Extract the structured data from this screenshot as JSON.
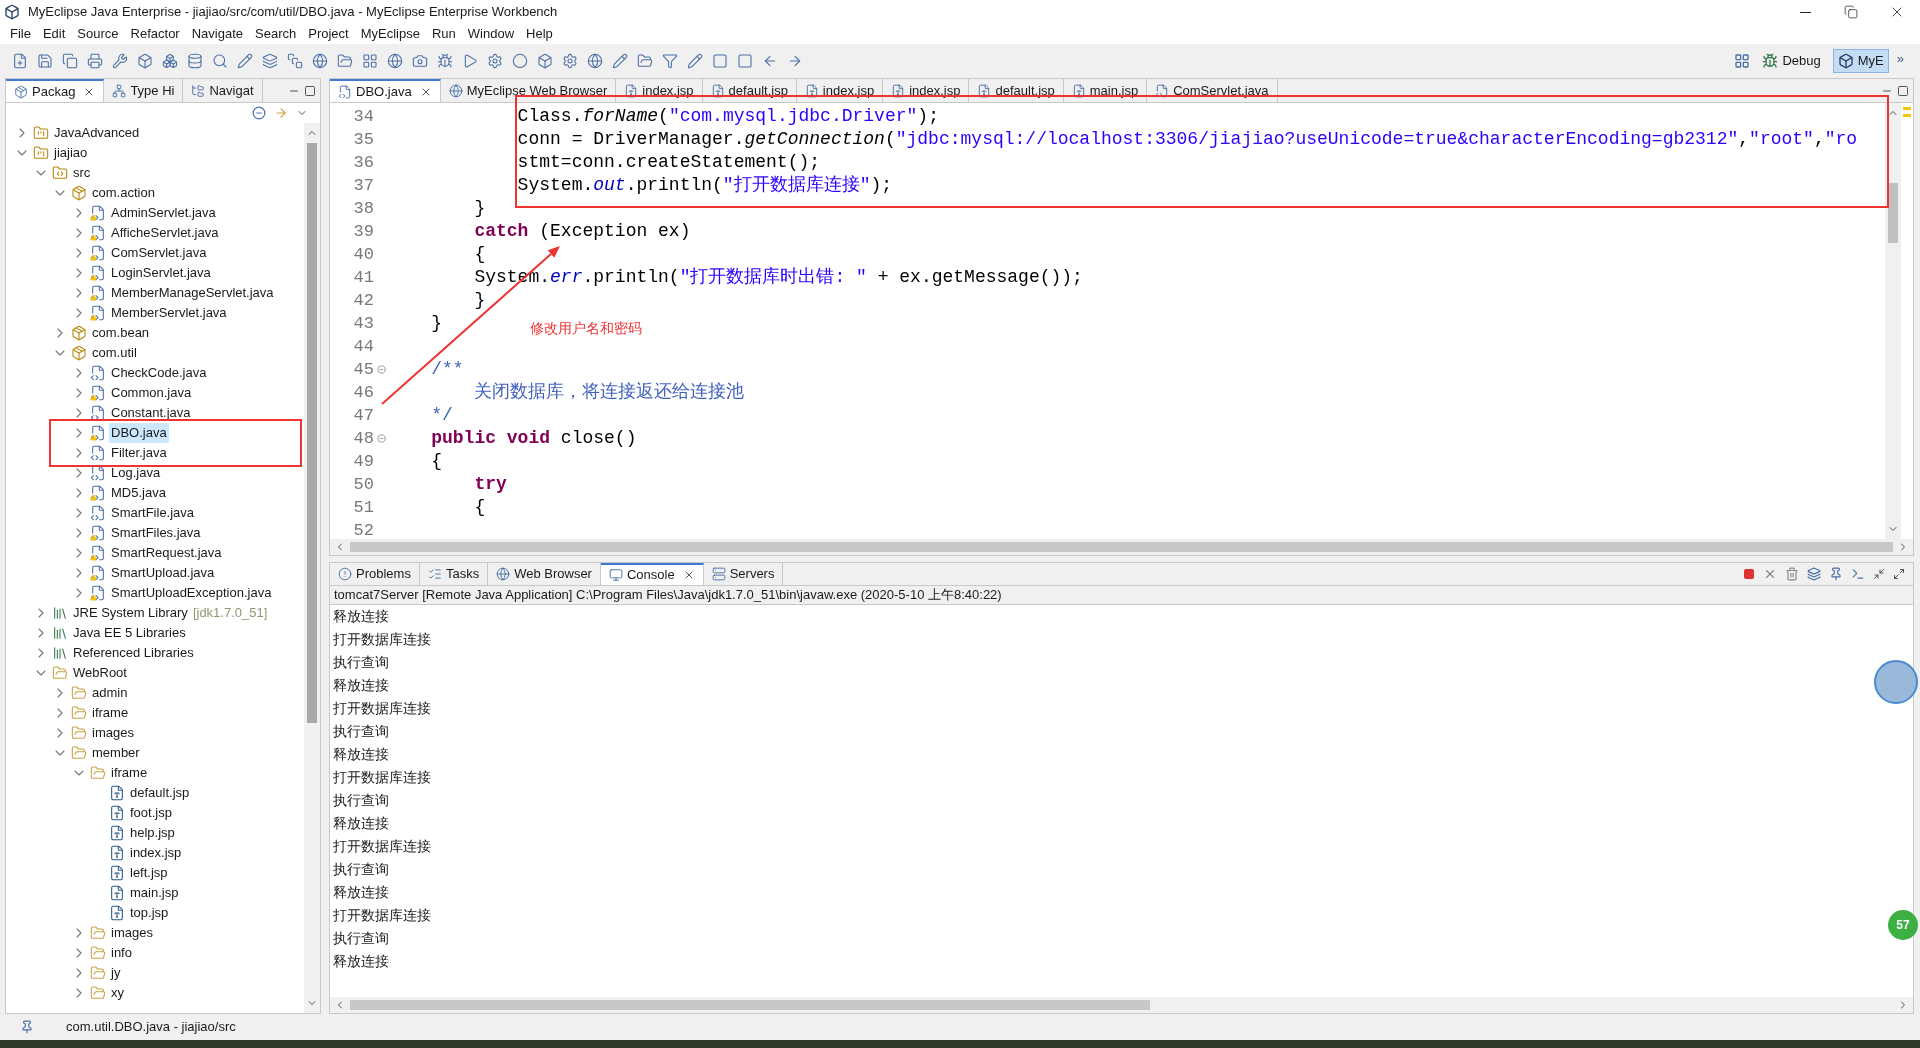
{
  "window": {
    "title": "MyEclipse Java Enterprise - jiajiao/src/com/util/DBO.java - MyEclipse Enterprise Workbench"
  },
  "menu": [
    "File",
    "Edit",
    "Source",
    "Refactor",
    "Navigate",
    "Search",
    "Project",
    "MyEclipse",
    "Run",
    "Window",
    "Help"
  ],
  "perspectives": [
    {
      "label": "Debug",
      "selected": false
    },
    {
      "label": "MyE",
      "selected": true
    }
  ],
  "perspective_more": "»",
  "left_tabs": [
    {
      "label": "Packag",
      "kind": "package",
      "selected": true
    },
    {
      "label": "Type Hi",
      "kind": "hierarchy",
      "selected": false
    },
    {
      "label": "Navigat",
      "kind": "navigator",
      "selected": false
    }
  ],
  "tree": [
    {
      "label": "JavaAdvanced",
      "kind": "project",
      "expanded": false
    },
    {
      "label": "jiajiao",
      "kind": "project",
      "expanded": true,
      "children": [
        {
          "label": "src",
          "kind": "source",
          "expanded": true,
          "children": [
            {
              "label": "com.action",
              "kind": "package",
              "expanded": true,
              "children": [
                {
                  "label": "AdminServlet.java",
                  "kind": "java",
                  "expanded": false,
                  "warning": true,
                  "selected": false
                },
                {
                  "label": "AfficheServlet.java",
                  "kind": "java",
                  "expanded": false,
                  "warning": true,
                  "selected": false
                },
                {
                  "label": "ComServlet.java",
                  "kind": "java",
                  "expanded": false,
                  "warning": true,
                  "selected": false
                },
                {
                  "label": "LoginServlet.java",
                  "kind": "java",
                  "expanded": false,
                  "warning": true,
                  "selected": false
                },
                {
                  "label": "MemberManageServlet.java",
                  "kind": "java",
                  "expanded": false,
                  "warning": true,
                  "selected": false
                },
                {
                  "label": "MemberServlet.java",
                  "kind": "java",
                  "expanded": false,
                  "warning": true,
                  "selected": false
                }
              ]
            },
            {
              "label": "com.bean",
              "kind": "package",
              "expanded": false
            },
            {
              "label": "com.util",
              "kind": "package",
              "expanded": true,
              "children": [
                {
                  "label": "CheckCode.java",
                  "kind": "java",
                  "expanded": false,
                  "warning": false,
                  "selected": false
                },
                {
                  "label": "Common.java",
                  "kind": "java",
                  "expanded": false,
                  "warning": true,
                  "selected": false
                },
                {
                  "label": "Constant.java",
                  "kind": "java",
                  "expanded": false,
                  "warning": false,
                  "selected": false
                },
                {
                  "label": "DBO.java",
                  "kind": "java",
                  "expanded": false,
                  "warning": true,
                  "selected": true
                },
                {
                  "label": "Filter.java",
                  "kind": "java",
                  "expanded": false,
                  "warning": false,
                  "selected": false
                },
                {
                  "label": "Log.java",
                  "kind": "java",
                  "expanded": false,
                  "warning": false,
                  "selected": false
                },
                {
                  "label": "MD5.java",
                  "kind": "java",
                  "expanded": false,
                  "warning": true,
                  "selected": false
                },
                {
                  "label": "SmartFile.java",
                  "kind": "java",
                  "expanded": false,
                  "warning": false,
                  "selected": false
                },
                {
                  "label": "SmartFiles.java",
                  "kind": "java",
                  "expanded": false,
                  "warning": true,
                  "selected": false
                },
                {
                  "label": "SmartRequest.java",
                  "kind": "java",
                  "expanded": false,
                  "warning": true,
                  "selected": false
                },
                {
                  "label": "SmartUpload.java",
                  "kind": "java",
                  "expanded": false,
                  "warning": true,
                  "selected": false
                },
                {
                  "label": "SmartUploadException.java",
                  "kind": "java",
                  "expanded": false,
                  "warning": true,
                  "selected": false
                }
              ]
            }
          ]
        },
        {
          "label": "JRE System Library",
          "decoration": "[jdk1.7.0_51]",
          "kind": "library",
          "expanded": false
        },
        {
          "label": "Java EE 5 Libraries",
          "kind": "library",
          "expanded": false
        },
        {
          "label": "Referenced Libraries",
          "kind": "library",
          "expanded": false
        },
        {
          "label": "WebRoot",
          "kind": "folder",
          "expanded": true,
          "children": [
            {
              "label": "admin",
              "kind": "folder",
              "expanded": false
            },
            {
              "label": "iframe",
              "kind": "folder",
              "expanded": false
            },
            {
              "label": "images",
              "kind": "folder",
              "expanded": false
            },
            {
              "label": "member",
              "kind": "folder",
              "expanded": true,
              "children": [
                {
                  "label": "iframe",
                  "kind": "folder",
                  "expanded": true,
                  "children": [
                    {
                      "label": "default.jsp",
                      "kind": "jsp"
                    },
                    {
                      "label": "foot.jsp",
                      "kind": "jsp"
                    },
                    {
                      "label": "help.jsp",
                      "kind": "jsp"
                    },
                    {
                      "label": "index.jsp",
                      "kind": "jsp"
                    },
                    {
                      "label": "left.jsp",
                      "kind": "jsp"
                    },
                    {
                      "label": "main.jsp",
                      "kind": "jsp"
                    },
                    {
                      "label": "top.jsp",
                      "kind": "jsp"
                    }
                  ]
                },
                {
                  "label": "images",
                  "kind": "folder",
                  "expanded": false
                },
                {
                  "label": "info",
                  "kind": "folder",
                  "expanded": false
                },
                {
                  "label": "jy",
                  "kind": "folder",
                  "expanded": false
                },
                {
                  "label": "xy",
                  "kind": "folder",
                  "expanded": false
                }
              ]
            }
          ]
        }
      ]
    }
  ],
  "editor_tabs": [
    {
      "label": "DBO.java",
      "kind": "java",
      "selected": true
    },
    {
      "label": "MyEclipse Web Browser",
      "kind": "browser",
      "selected": false
    },
    {
      "label": "index.jsp",
      "kind": "jsp",
      "selected": false
    },
    {
      "label": "default.jsp",
      "kind": "jsp",
      "selected": false
    },
    {
      "label": "index.jsp",
      "kind": "jsp",
      "selected": false
    },
    {
      "label": "index.jsp",
      "kind": "jsp",
      "selected": false
    },
    {
      "label": "default.jsp",
      "kind": "jsp",
      "selected": false
    },
    {
      "label": "main.jsp",
      "kind": "jsp",
      "selected": false
    },
    {
      "label": "ComServlet.java",
      "kind": "java",
      "selected": false
    }
  ],
  "code_lines": [
    {
      "number": "34",
      "tokens": [
        {
          "kind": "plain",
          "text": "            Class."
        },
        {
          "kind": "method",
          "text": "forName"
        },
        {
          "kind": "plain",
          "text": "("
        },
        {
          "kind": "string",
          "text": "\"com.mysql.jdbc.Driver\""
        },
        {
          "kind": "plain",
          "text": ");"
        }
      ]
    },
    {
      "number": "35",
      "tokens": [
        {
          "kind": "plain",
          "text": "            conn = DriverManager."
        },
        {
          "kind": "method",
          "text": "getConnection"
        },
        {
          "kind": "plain",
          "text": "("
        },
        {
          "kind": "string",
          "text": "\"jdbc:mysql://localhost:3306/jiajiao?useUnicode=true&characterEncoding=gb2312\""
        },
        {
          "kind": "plain",
          "text": ","
        },
        {
          "kind": "string",
          "text": "\"root\""
        },
        {
          "kind": "plain",
          "text": ","
        },
        {
          "kind": "string",
          "text": "\"ro"
        }
      ]
    },
    {
      "number": "36",
      "tokens": [
        {
          "kind": "plain",
          "text": "            stmt=conn.createStatement();"
        }
      ]
    },
    {
      "number": "37",
      "tokens": [
        {
          "kind": "plain",
          "text": "            System."
        },
        {
          "kind": "field",
          "text": "out"
        },
        {
          "kind": "plain",
          "text": ".println("
        },
        {
          "kind": "string",
          "text": "\"打开数据库连接\""
        },
        {
          "kind": "plain",
          "text": ");"
        }
      ]
    },
    {
      "number": "38",
      "tokens": [
        {
          "kind": "plain",
          "text": "        }"
        }
      ]
    },
    {
      "number": "39",
      "tokens": [
        {
          "kind": "keyword",
          "text": "        catch"
        },
        {
          "kind": "plain",
          "text": " (Exception ex)"
        }
      ]
    },
    {
      "number": "40",
      "tokens": [
        {
          "kind": "plain",
          "text": "        {"
        }
      ]
    },
    {
      "number": "41",
      "tokens": [
        {
          "kind": "plain",
          "text": "        System."
        },
        {
          "kind": "field",
          "text": "err"
        },
        {
          "kind": "plain",
          "text": ".println("
        },
        {
          "kind": "string",
          "text": "\"打开数据库时出错: \""
        },
        {
          "kind": "plain",
          "text": " + ex.getMessage());"
        }
      ]
    },
    {
      "number": "42",
      "tokens": [
        {
          "kind": "plain",
          "text": "        }"
        }
      ]
    },
    {
      "number": "43",
      "tokens": [
        {
          "kind": "plain",
          "text": "    }"
        }
      ]
    },
    {
      "number": "44"
    },
    {
      "number": "45",
      "fold": true,
      "tokens": [
        {
          "kind": "comment",
          "text": "    /**"
        }
      ]
    },
    {
      "number": "46",
      "tokens": [
        {
          "kind": "comment",
          "text": "        关闭数据库，将连接返还给连接池"
        }
      ]
    },
    {
      "number": "47",
      "tokens": [
        {
          "kind": "comment",
          "text": "    */"
        }
      ]
    },
    {
      "number": "48",
      "fold": true,
      "tokens": [
        {
          "kind": "keyword",
          "text": "    public void"
        },
        {
          "kind": "plain",
          "text": " close()"
        }
      ]
    },
    {
      "number": "49",
      "tokens": [
        {
          "kind": "plain",
          "text": "    {"
        }
      ]
    },
    {
      "number": "50",
      "tokens": [
        {
          "kind": "keyword",
          "text": "        try"
        }
      ]
    },
    {
      "number": "51",
      "tokens": [
        {
          "kind": "plain",
          "text": "        {"
        }
      ]
    },
    {
      "number": "52"
    }
  ],
  "console_tabs": [
    {
      "label": "Problems",
      "kind": "problems",
      "selected": false
    },
    {
      "label": "Tasks",
      "kind": "tasks",
      "selected": false
    },
    {
      "label": "Web Browser",
      "kind": "browser",
      "selected": false
    },
    {
      "label": "Console",
      "kind": "console",
      "selected": true
    },
    {
      "label": "Servers",
      "kind": "servers",
      "selected": false
    }
  ],
  "console_header": "tomcat7Server [Remote Java Application] C:\\Program Files\\Java\\jdk1.7.0_51\\bin\\javaw.exe (2020-5-10 上午8:40:22)",
  "console_lines": [
    "释放连接",
    "打开数据库连接",
    "执行查询",
    "释放连接",
    "打开数据库连接",
    "执行查询",
    "释放连接",
    "打开数据库连接",
    "执行查询",
    "释放连接",
    "打开数据库连接",
    "执行查询",
    "释放连接",
    "打开数据库连接",
    "执行查询",
    "释放连接"
  ],
  "annotation": {
    "note": "修改用户名和密码"
  },
  "floating_badge": "57",
  "status_bar": {
    "text": "com.util.DBO.java - jiajiao/src"
  }
}
